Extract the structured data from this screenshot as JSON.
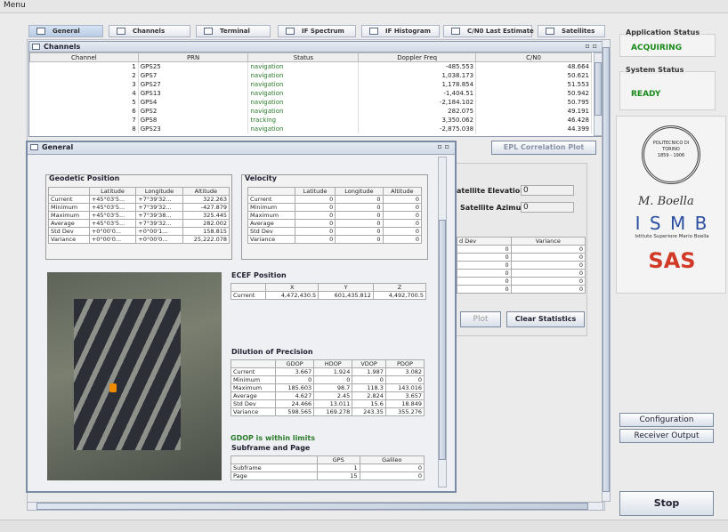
{
  "menu": {
    "label": "Menu"
  },
  "tabs": [
    {
      "label": "General",
      "selected": true
    },
    {
      "label": "Channels"
    },
    {
      "label": "Terminal"
    },
    {
      "label": "IF Spectrum"
    },
    {
      "label": "IF Histogram"
    },
    {
      "label": "C/N0 Last Estimate"
    },
    {
      "label": "Satellites"
    }
  ],
  "channels": {
    "title": "Channels",
    "headers": [
      "Channel",
      "PRN",
      "Status",
      "Doppler Freq",
      "C/N0"
    ],
    "rows": [
      [
        "1",
        "GPS25",
        "navigation",
        "-485.553",
        "48.664"
      ],
      [
        "2",
        "GPS7",
        "navigation",
        "1,038.173",
        "50.621"
      ],
      [
        "3",
        "GPS27",
        "navigation",
        "1,178.854",
        "51.553"
      ],
      [
        "4",
        "GPS13",
        "navigation",
        "-1,404.51",
        "50.942"
      ],
      [
        "5",
        "GPS4",
        "navigation",
        "-2,184.102",
        "50.795"
      ],
      [
        "6",
        "GPS2",
        "navigation",
        "282.075",
        "49.191"
      ],
      [
        "7",
        "GPS8",
        "tracking",
        "3,350.062",
        "46.428"
      ],
      [
        "8",
        "GPS23",
        "navigation",
        "-2,875.038",
        "44.399"
      ]
    ]
  },
  "epl_button": "EPL Correlation Plot",
  "behind": {
    "sat_elev_label": "atellite Elevation:",
    "sat_elev_val": "0",
    "sat_azim_label": "Satellite Azimut:",
    "sat_azim_val": "0",
    "stddev_header": "d Dev",
    "variance_header": "Variance",
    "zeros": [
      "0",
      "0",
      "0",
      "0",
      "0",
      "0"
    ],
    "plot_button": "Plot",
    "clear_button": "Clear Statistics"
  },
  "general": {
    "title": "General",
    "geodetic": {
      "title": "Geodetic Position",
      "headers": [
        "",
        "Latitude",
        "Longitude",
        "Altitude"
      ],
      "rows": [
        [
          "Current",
          "+45°03'5...",
          "+7°39'32...",
          "322.263"
        ],
        [
          "Minimum",
          "+45°03'5...",
          "+7°39'32...",
          "-427.879"
        ],
        [
          "Maximum",
          "+45°03'5...",
          "+7°39'38...",
          "325.445"
        ],
        [
          "Average",
          "+45°03'5...",
          "+7°39'32...",
          "282.002"
        ],
        [
          "Std Dev",
          "+0°00'0...",
          "+0°00'1...",
          "158.815"
        ],
        [
          "Variance",
          "+0°00'0...",
          "+0°00'0...",
          "25,222.078"
        ]
      ]
    },
    "velocity": {
      "title": "Velocity",
      "headers": [
        "",
        "Latitude",
        "Longitude",
        "Altitude"
      ],
      "rows": [
        [
          "Current",
          "0",
          "0",
          "0"
        ],
        [
          "Minimum",
          "0",
          "0",
          "0"
        ],
        [
          "Maximum",
          "0",
          "0",
          "0"
        ],
        [
          "Average",
          "0",
          "0",
          "0"
        ],
        [
          "Std Dev",
          "0",
          "0",
          "0"
        ],
        [
          "Variance",
          "0",
          "0",
          "0"
        ]
      ]
    },
    "ecef": {
      "title": "ECEF Position",
      "headers": [
        "",
        "X",
        "Y",
        "Z"
      ],
      "row": [
        "Current",
        "4,472,430.5",
        "601,435.812",
        "4,492,700.5"
      ]
    },
    "dop": {
      "title": "Dilution of Precision",
      "headers": [
        "",
        "GDOP",
        "HDOP",
        "VDOP",
        "PDOP"
      ],
      "rows": [
        [
          "Current",
          "3.667",
          "1.924",
          "1.987",
          "3.082"
        ],
        [
          "Minimum",
          "0",
          "0",
          "0",
          "0"
        ],
        [
          "Maximum",
          "185.603",
          "98.7",
          "118.3",
          "143.016"
        ],
        [
          "Average",
          "4.627",
          "2.45",
          "2.824",
          "3.657"
        ],
        [
          "Std Dev",
          "24.466",
          "13.011",
          "15.6",
          "18.849"
        ],
        [
          "Variance",
          "598.565",
          "169.278",
          "243.35",
          "355.276"
        ]
      ],
      "status": "GDOP is within limits"
    },
    "subframe": {
      "title": "Subframe and Page",
      "headers": [
        "",
        "GPS",
        "Galileo"
      ],
      "rows": [
        [
          "Subframe",
          "1",
          "0"
        ],
        [
          "Page",
          "15",
          "0"
        ]
      ]
    }
  },
  "status": {
    "app_label": "Application Status",
    "app_value": "ACQUIRING",
    "sys_label": "System Status",
    "sys_value": "READY",
    "accent": "#1a8a1a"
  },
  "logos": {
    "polito": "POLITECNICO DI TORINO",
    "polito_years": "1859 - 1906",
    "signature": "M. Boella",
    "ismb": "I S M B",
    "ismb_sub": "Istituto Superiore Mario Boella",
    "sas": "SAS"
  },
  "buttons": {
    "configuration": "Configuration",
    "receiver_output": "Receiver Output",
    "stop": "Stop"
  }
}
